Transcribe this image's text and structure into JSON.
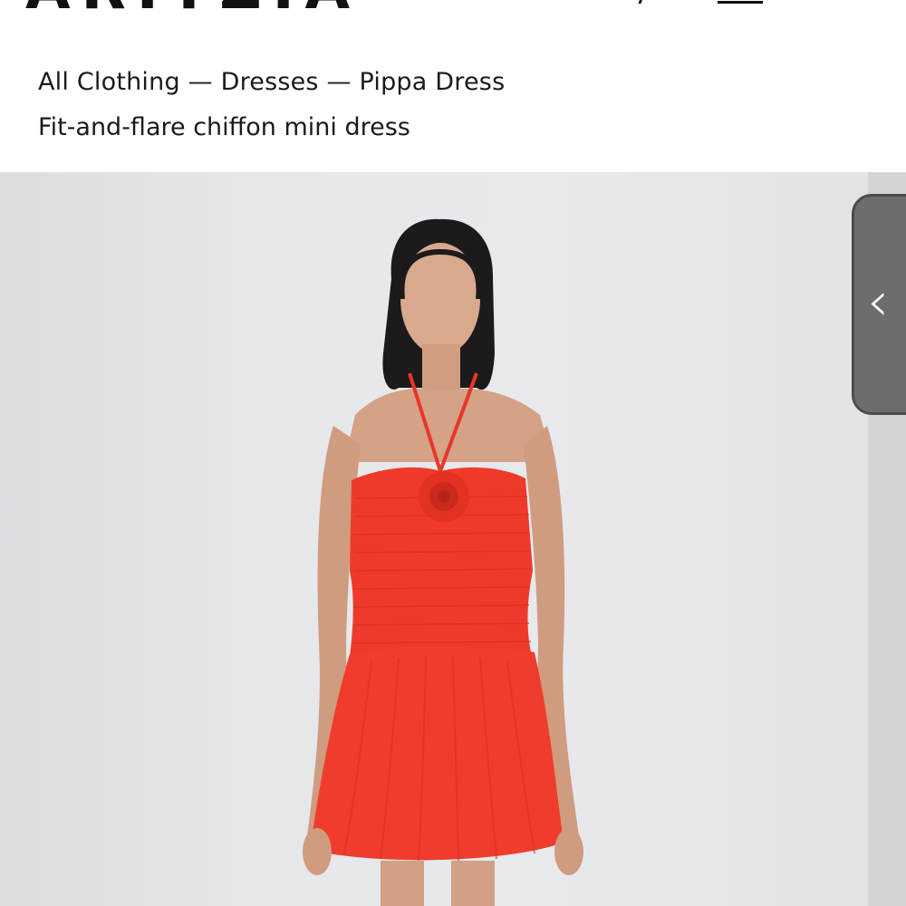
{
  "header": {
    "logo_text": "ARITZIA"
  },
  "breadcrumb": {
    "items": [
      "All Clothing",
      "Dresses",
      "Pippa Dress"
    ],
    "separator": "—"
  },
  "product": {
    "subtitle": "Fit-and-flare chiffon mini dress",
    "dress_color": "#f0392a"
  },
  "gallery": {
    "drawer_icon": "chevron-left-icon"
  }
}
